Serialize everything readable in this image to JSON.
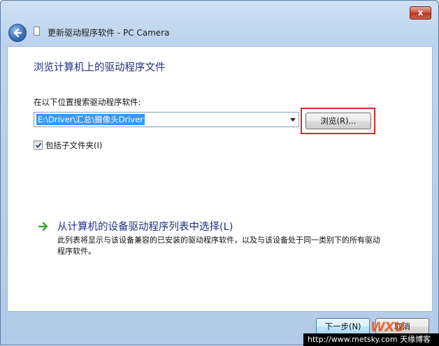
{
  "window": {
    "title": "更新驱动程序软件 - PC Camera",
    "close_glyph": "x"
  },
  "main": {
    "heading": "浏览计算机上的驱动程序文件",
    "search_label": "在以下位置搜索驱动程序软件:",
    "path_value": "E:\\Driver\\汇总\\摄像头Driver",
    "browse_label": "浏览(R)...",
    "include_subfolders": {
      "label": "包括子文件夹(I)",
      "checked": true
    },
    "pick_from_list": {
      "title": "从计算机的设备驱动程序列表中选择(L)",
      "description": "此列表将显示与该设备兼容的已安装的驱动程序软件，以及与该设备处于同一类别下的所有驱动程序软件。"
    }
  },
  "footer": {
    "next_label": "下一步(N)",
    "cancel_label": "取消"
  },
  "watermark": {
    "logo": "WXU",
    "site": "http://www.metsky.com 天缘博客"
  },
  "colors": {
    "accent_heading": "#1e3287",
    "selection": "#3399ff",
    "highlight_border": "#d4282d",
    "link_arrow": "#3aa83a"
  },
  "icons": {
    "back": "back-arrow-icon",
    "title_doc": "document-icon",
    "close": "close-icon",
    "dropdown": "chevron-down-icon",
    "check": "checkmark-icon",
    "link_arrow": "green-arrow-icon"
  }
}
